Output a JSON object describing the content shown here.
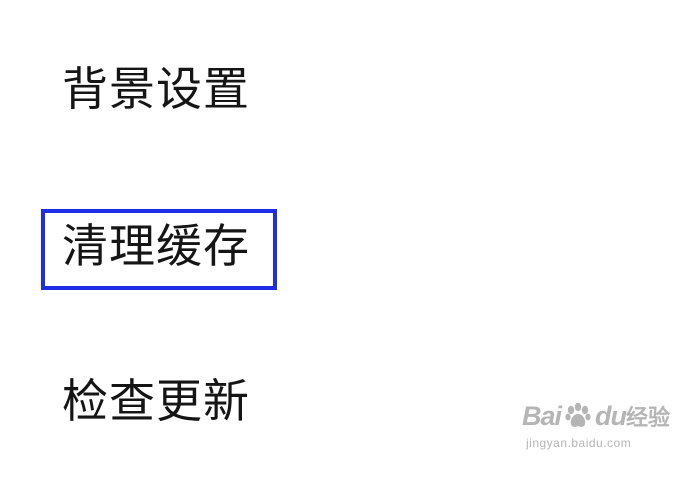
{
  "settings_menu": {
    "items": [
      {
        "label": "背景设置"
      },
      {
        "label": "清理缓存",
        "highlighted": true
      },
      {
        "label": "检查更新"
      }
    ],
    "highlight_color": "#1f2ee6"
  },
  "watermark": {
    "brand_prefix": "Bai",
    "brand_suffix": "du",
    "product": "经验",
    "url": "jingyan.baidu.com",
    "icon": "paw-icon"
  }
}
